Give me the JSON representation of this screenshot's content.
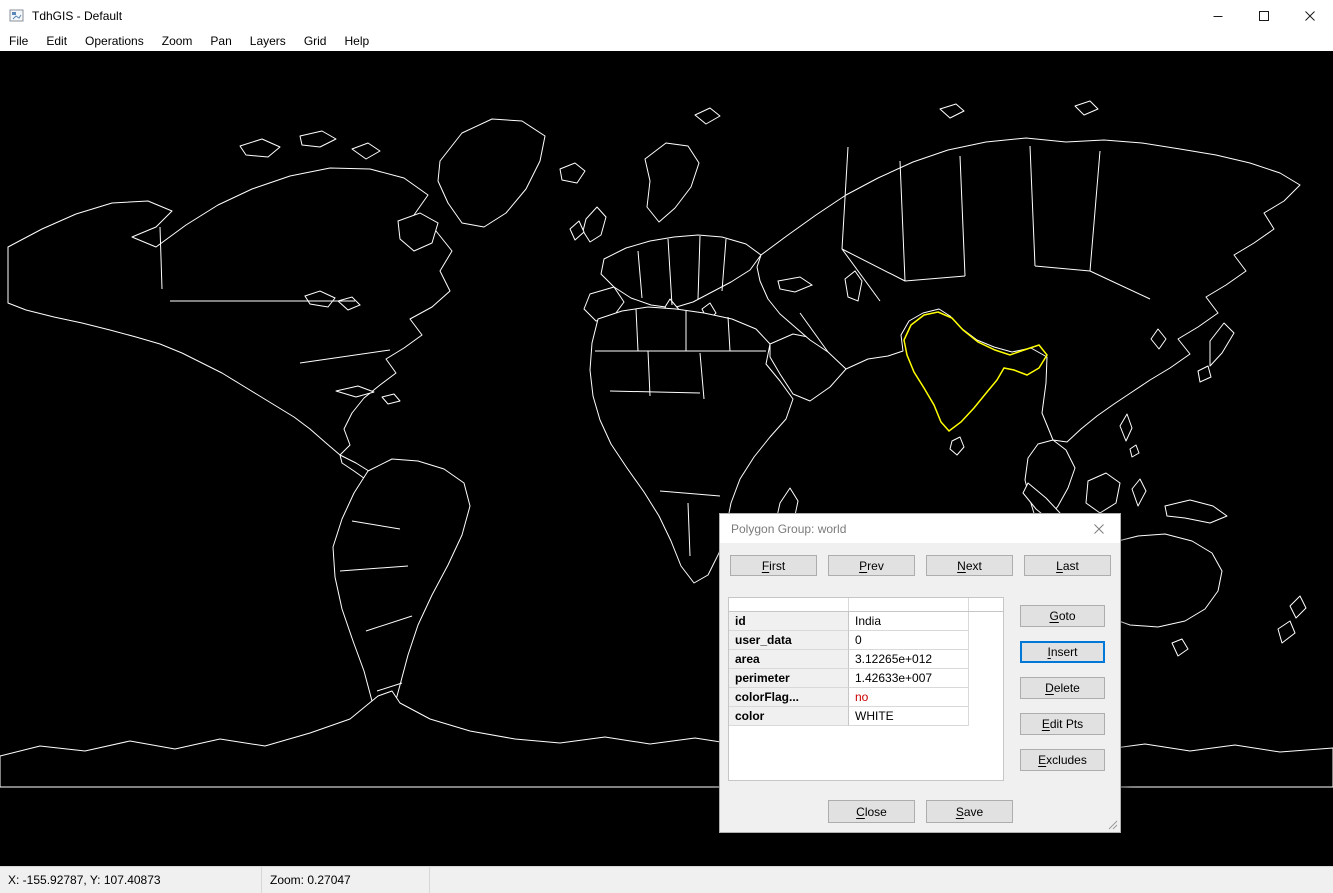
{
  "window": {
    "title": "TdhGIS - Default"
  },
  "menu": {
    "items": [
      "File",
      "Edit",
      "Operations",
      "Zoom",
      "Pan",
      "Layers",
      "Grid",
      "Help"
    ]
  },
  "map": {
    "background": "#000000",
    "outline_color": "#ffffff",
    "highlight_color": "#ffff00",
    "highlighted_polygon": "India"
  },
  "dialog": {
    "title": "Polygon Group: world",
    "nav_buttons": [
      {
        "mnemonic": "F",
        "rest": "irst"
      },
      {
        "mnemonic": "P",
        "rest": "rev"
      },
      {
        "mnemonic": "N",
        "rest": "ext"
      },
      {
        "mnemonic": "L",
        "rest": "ast"
      }
    ],
    "table": {
      "rows": [
        {
          "field": "id",
          "value": "India"
        },
        {
          "field": "user_data",
          "value": "0"
        },
        {
          "field": "area",
          "value": "3.12265e+012"
        },
        {
          "field": "perimeter",
          "value": "1.42633e+007"
        },
        {
          "field": "colorFlag...",
          "value": "no",
          "value_color": "#cc0000"
        },
        {
          "field": "color",
          "value": "WHITE"
        }
      ]
    },
    "side_buttons": [
      {
        "mnemonic": "G",
        "rest": "oto",
        "focused": false
      },
      {
        "mnemonic": "I",
        "rest": "nsert",
        "focused": true
      },
      {
        "mnemonic": "D",
        "rest": "elete",
        "focused": false
      },
      {
        "mnemonic": "E",
        "rest": "dit Pts",
        "focused": false
      },
      {
        "mnemonic": "E",
        "rest": "xcludes",
        "focused": false
      }
    ],
    "bottom_buttons": [
      {
        "mnemonic": "C",
        "rest": "lose"
      },
      {
        "mnemonic": "S",
        "rest": "ave"
      }
    ]
  },
  "colors": {
    "focus_border": "#0078d7",
    "error_text": "#cc0000"
  },
  "statusbar": {
    "coordinates": "X: -155.92787, Y: 107.40873",
    "zoom": "Zoom: 0.27047"
  }
}
